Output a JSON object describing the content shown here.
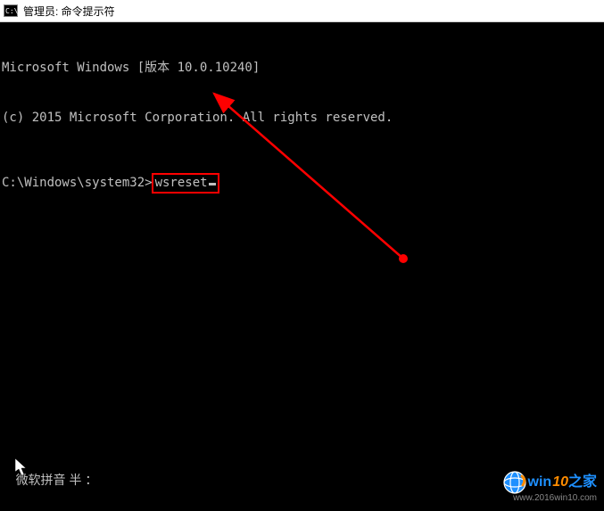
{
  "titlebar": {
    "icon_label": "C:\\",
    "title": "管理员: 命令提示符"
  },
  "terminal": {
    "line1": "Microsoft Windows [版本 10.0.10240]",
    "line2": "(c) 2015 Microsoft Corporation. All rights reserved.",
    "prompt": "C:\\Windows\\system32>",
    "command": "wsreset"
  },
  "ime": {
    "status": "微软拼音 半 ："
  },
  "watermark": {
    "brand_win": "win",
    "brand_10": "10",
    "brand_suffix": "之家",
    "url": "www.2016win10.com"
  },
  "annotation": {
    "type": "arrow",
    "color": "#ff0000"
  }
}
